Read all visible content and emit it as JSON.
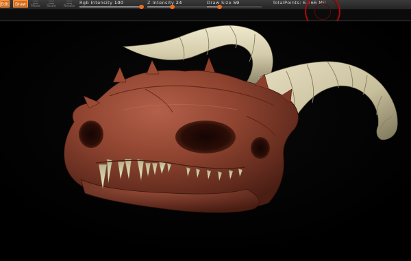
{
  "toolbar": {
    "tools": [
      {
        "label": "Edit",
        "state": "active"
      },
      {
        "label": "Draw",
        "state": "active"
      },
      {
        "label": "Move",
        "state": "inactive"
      },
      {
        "label": "Scale",
        "state": "inactive"
      },
      {
        "label": "Rotate",
        "state": "inactive"
      }
    ],
    "rgb_intensity": {
      "label": "Rgb Intensity",
      "value": "100",
      "level": 1.0
    },
    "z_intensity": {
      "label": "Z Intensity",
      "value": "24",
      "level": 0.24
    },
    "draw_size": {
      "label": "Draw Size",
      "value": "59",
      "level": 0.22
    },
    "total_points": {
      "label": "TotalPoints:",
      "value": "6.766 Mil"
    }
  },
  "viewport": {
    "model": "dragon-skull",
    "colors": {
      "background": "#000000",
      "skull": "#8a3e2a",
      "horn": "#d9d2b4",
      "teeth": "#e8e2bc",
      "accent_orange": "#d46d1f",
      "nav_circle": "#a40c0c"
    }
  }
}
